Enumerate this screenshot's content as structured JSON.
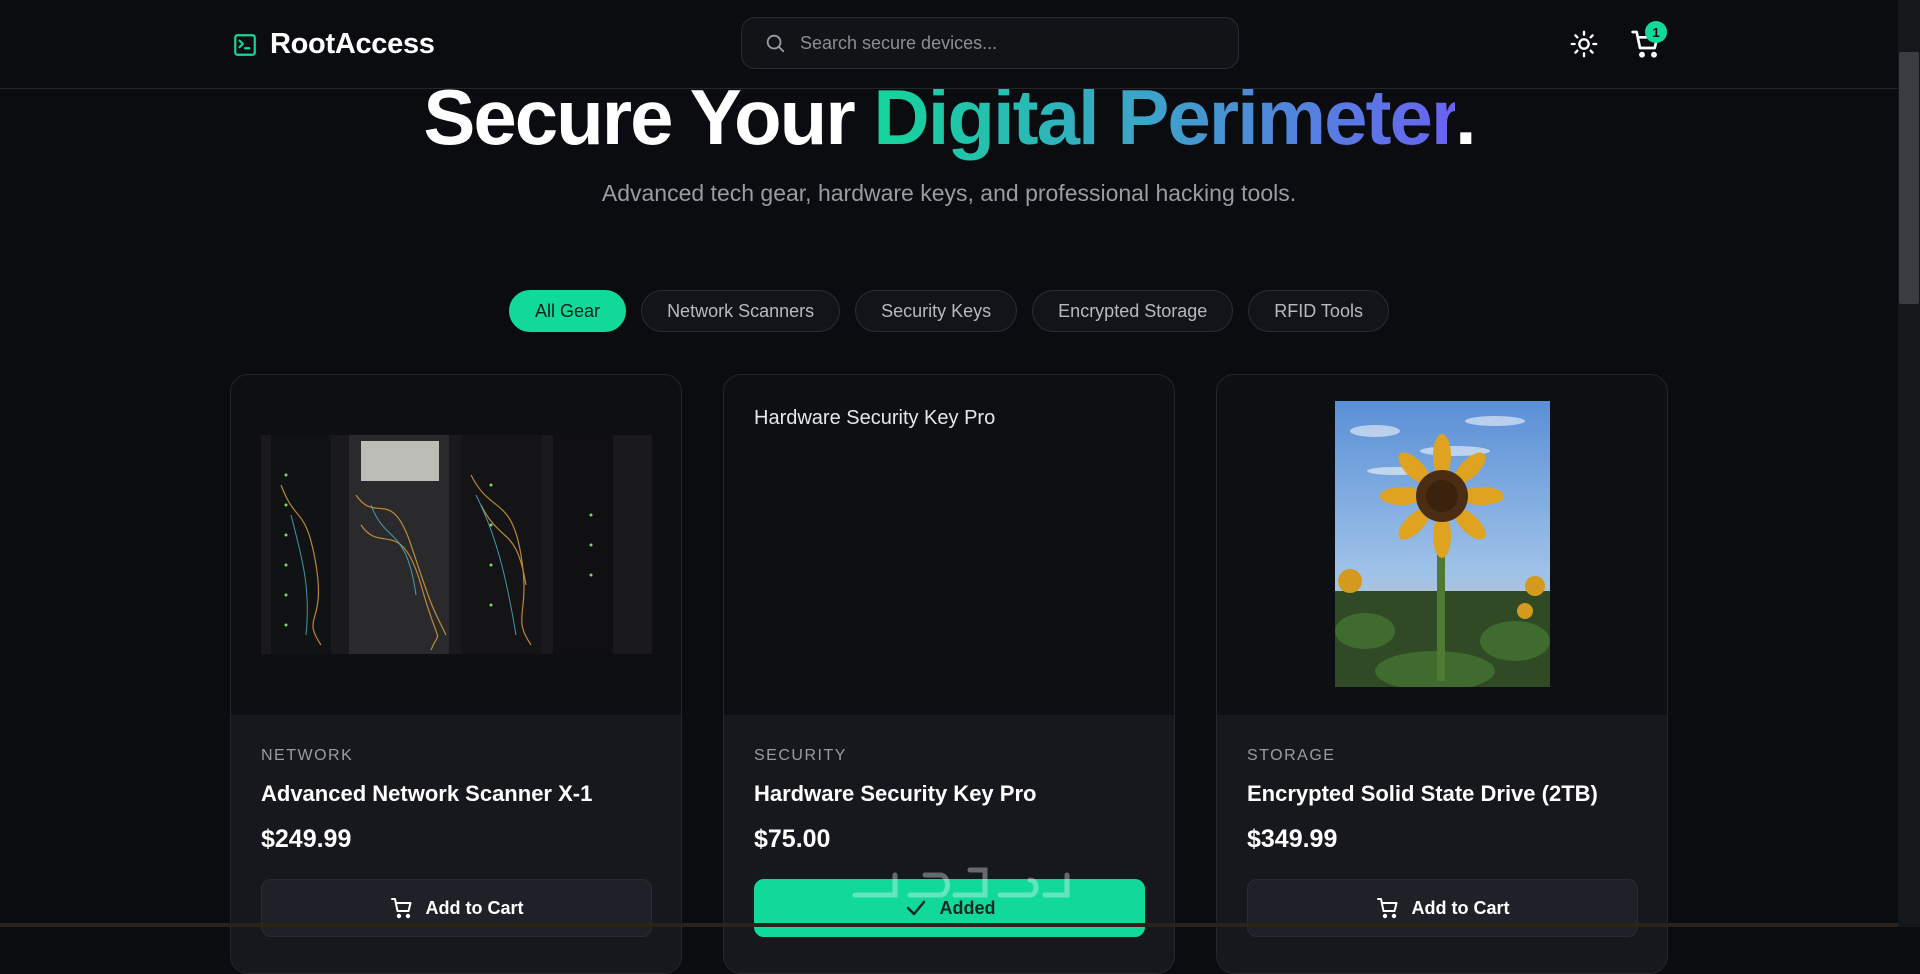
{
  "header": {
    "brand": "RootAccess",
    "search_placeholder": "Search secure devices...",
    "cart_count": "1"
  },
  "hero": {
    "title_plain": "Secure Your ",
    "title_highlight": "Digital Perimeter",
    "title_end": ".",
    "subtitle": "Advanced tech gear, hardware keys, and professional hacking tools."
  },
  "filters": [
    {
      "label": "All Gear",
      "active": true
    },
    {
      "label": "Network Scanners",
      "active": false
    },
    {
      "label": "Security Keys",
      "active": false
    },
    {
      "label": "Encrypted Storage",
      "active": false
    },
    {
      "label": "RFID Tools",
      "active": false
    }
  ],
  "products": [
    {
      "category": "NETWORK",
      "title": "Advanced Network Scanner X-1",
      "price": "$249.99",
      "button": "Add to Cart",
      "image": "server-rack-photo"
    },
    {
      "category": "SECURITY",
      "title": "Hardware Security Key Pro",
      "price": "$75.00",
      "button": "Added",
      "image_alt": "Hardware Security Key Pro"
    },
    {
      "category": "STORAGE",
      "title": "Encrypted Solid State Drive (2TB)",
      "price": "$349.99",
      "button": "Add to Cart",
      "image": "sunflower-photo"
    }
  ],
  "colors": {
    "accent": "#10d99a",
    "background": "#0b0c0f",
    "card": "#17181d",
    "gradient_start": "#14d59a",
    "gradient_end": "#6a62f2"
  },
  "icons": [
    "terminal-icon",
    "search-icon",
    "sun-icon",
    "cart-icon",
    "check-icon"
  ]
}
